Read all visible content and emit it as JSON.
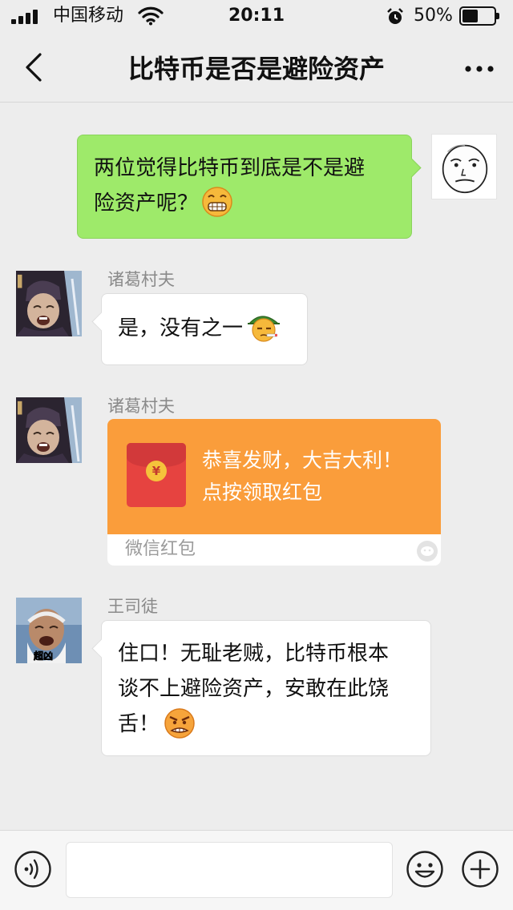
{
  "status_bar": {
    "carrier": "中国移动",
    "time": "20:11",
    "battery_percent_text": "50%",
    "battery_level": 0.5,
    "signal_bars": 4,
    "icons": [
      "signal-icon",
      "wifi-icon",
      "alarm-icon",
      "battery-icon"
    ]
  },
  "nav": {
    "title": "比特币是否是避险资产",
    "back_icon": "chevron-left-icon",
    "more_icon": "ellipsis-icon"
  },
  "messages": [
    {
      "direction": "outgoing",
      "avatar": "rage-face-meme",
      "text": "两位觉得比特币到底是不是避险资产呢？",
      "line1": "两位觉得比特币到底是不是避",
      "line2": "险资产呢？",
      "emoji": "grimace-emoji"
    },
    {
      "direction": "incoming",
      "sender": "诸葛村夫",
      "avatar": "old-man-meme",
      "text": "是，没有之一",
      "emoji": "smoking-soldier-emoji"
    },
    {
      "direction": "incoming",
      "sender": "诸葛村夫",
      "avatar": "old-man-meme",
      "type": "red_packet",
      "red_packet": {
        "greeting_line1": "恭喜发财，大吉大利！",
        "greeting_line2": "点按领取红包",
        "footer": "微信红包",
        "coin_symbol": "¥"
      }
    },
    {
      "direction": "incoming",
      "sender": "王司徒",
      "avatar": "wang-situ-meme",
      "avatar_caption": "超凶",
      "line1": "住口！无耻老贼，比特币根本",
      "line2": "谈不上避险资产，安敢在此饶",
      "line3": "舌！",
      "emoji": "angry-face-emoji"
    }
  ],
  "input_bar": {
    "value": "",
    "placeholder": "",
    "icons": [
      "voice-icon",
      "emoji-icon",
      "plus-icon"
    ]
  },
  "colors": {
    "background": "#ededed",
    "outgoing_bubble": "#9eea6a",
    "incoming_bubble": "#ffffff",
    "red_packet": "#fa9d3b",
    "envelope": "#e64340"
  }
}
